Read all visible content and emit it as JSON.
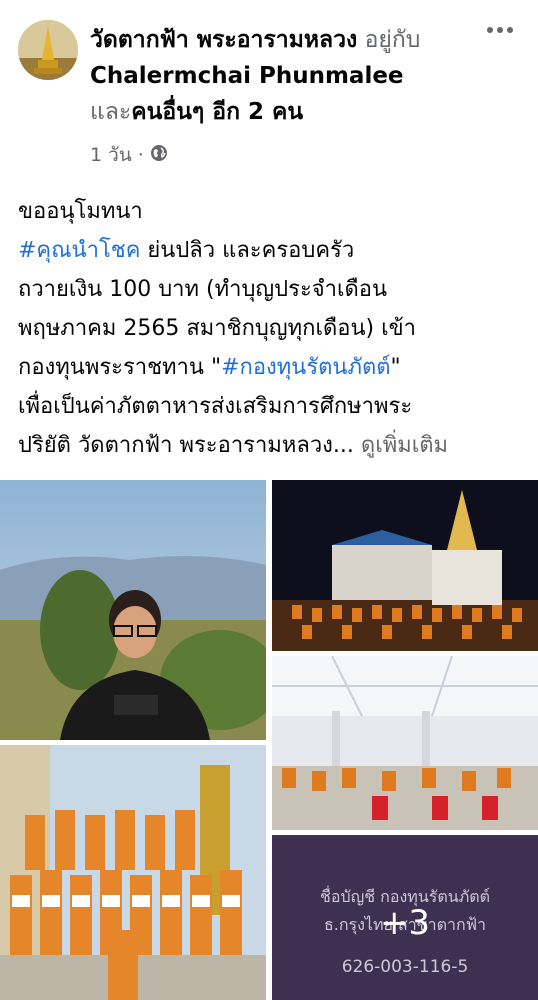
{
  "post": {
    "page_name": "วัดตากฟ้า พระอารามหลวง",
    "with_word": "อยู่กับ",
    "with_name": "Chalermchai Phunmalee",
    "and_word": "และ",
    "others": "คนอื่นๆ อีก 2 คน",
    "time": "1 วัน",
    "visibility_icon": "globe-icon",
    "more_icon": "more-dots-icon"
  },
  "body": {
    "line1": "ขออนุโมทนา",
    "hashtag1": "#คุณนำโชค",
    "line2_rest": " ย่นปลิว  และครอบครัว",
    "line3": "ถวายเงิน 100 บาท (ทำบุญประจำเดือน",
    "line4": "พฤษภาคม 2565 สมาชิกบุญทุกเดือน) เข้า",
    "line5_pre": "กองทุนพระราชทาน \"",
    "hashtag2": "#กองทุนรัตนภัตต์",
    "line5_post": "\"",
    "line6": "เพื่อเป็นค่าภัตตาหารส่งเสริมการศึกษาพระ",
    "line7": "ปริยัติ วัดตากฟ้า พระอารามหลวง...",
    "see_more": "ดูเพิ่มเติม"
  },
  "photos": {
    "account_line1": "ชื่อบัญชี กองทุนรัตนภัตต์",
    "account_line2": "ธ.กรุงไทย สาขาตากฟ้า",
    "account_number": "626-003-116-5",
    "more_count": "+3"
  }
}
